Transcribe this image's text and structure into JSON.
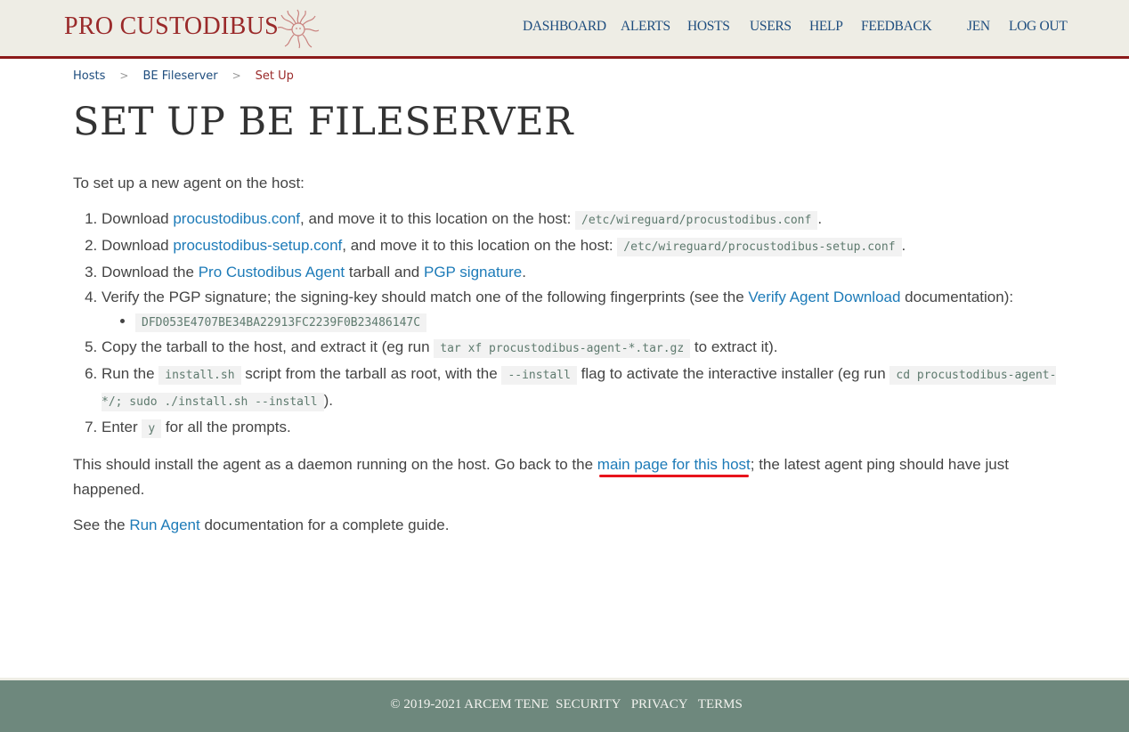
{
  "header": {
    "logo_text": "PRO CUSTODIBUS",
    "nav": [
      {
        "label": "DASHBOARD"
      },
      {
        "label": "ALERTS"
      },
      {
        "label": "HOSTS"
      },
      {
        "label": "USERS"
      },
      {
        "label": "HELP"
      },
      {
        "label": "FEEDBACK"
      }
    ],
    "user": "JEN",
    "logout": "LOG OUT"
  },
  "breadcrumb": {
    "items": [
      "Hosts",
      "BE Fileserver"
    ],
    "separator": ">",
    "current": "Set Up"
  },
  "page_title": "SET UP BE FILESERVER",
  "intro": "To set up a new agent on the host:",
  "steps": {
    "s1": {
      "pre": "Download ",
      "link": "procustodibus.conf",
      "mid": ", and move it to this location on the host: ",
      "code": "/etc/wireguard/procustodibus.conf",
      "post": "."
    },
    "s2": {
      "pre": "Download ",
      "link": "procustodibus-setup.conf",
      "mid": ", and move it to this location on the host: ",
      "code": "/etc/wireguard/procustodibus-setup.conf",
      "post": "."
    },
    "s3": {
      "pre": "Download the ",
      "link1": "Pro Custodibus Agent",
      "mid": " tarball and ",
      "link2": "PGP signature",
      "post": "."
    },
    "s4": {
      "pre": "Verify the PGP signature; the signing-key should match one of the following fingerprints (see the ",
      "link": "Verify Agent Download",
      "post": " documentation):",
      "fingerprints": [
        "DFD053E4707BE34BA22913FC2239F0B23486147C"
      ]
    },
    "s5": {
      "pre": "Copy the tarball to the host, and extract it (eg run ",
      "code": "tar xf procustodibus-agent-*.tar.gz",
      "post": " to extract it)."
    },
    "s6": {
      "pre": "Run the ",
      "code1": "install.sh",
      "mid1": " script from the tarball as root, with the ",
      "code2": "--install",
      "mid2": " flag to activate the interactive installer (eg run ",
      "code3": "cd procustodibus-agent-*/; sudo ./install.sh --install",
      "post": ")."
    },
    "s7": {
      "pre": "Enter ",
      "code": "y",
      "post": " for all the prompts."
    }
  },
  "outro": {
    "pre": "This should install the agent as a daemon running on the host. Go back to the ",
    "link": "main page for this host",
    "post": "; the latest agent ping should have just happened."
  },
  "guide": {
    "pre": "See the ",
    "link": "Run Agent",
    "post": " documentation for a complete guide."
  },
  "footer": {
    "copyright": "© 2019-2021 ARCEM TENE",
    "links": [
      "SECURITY",
      "PRIVACY",
      "TERMS"
    ]
  },
  "colors": {
    "brand_red": "#8b1a1a",
    "nav_blue": "#1e4d7e",
    "link_blue": "#1d7bb8",
    "header_bg": "#eeede5",
    "footer_bg": "#6e887d",
    "annotation_red": "#e8131b"
  }
}
